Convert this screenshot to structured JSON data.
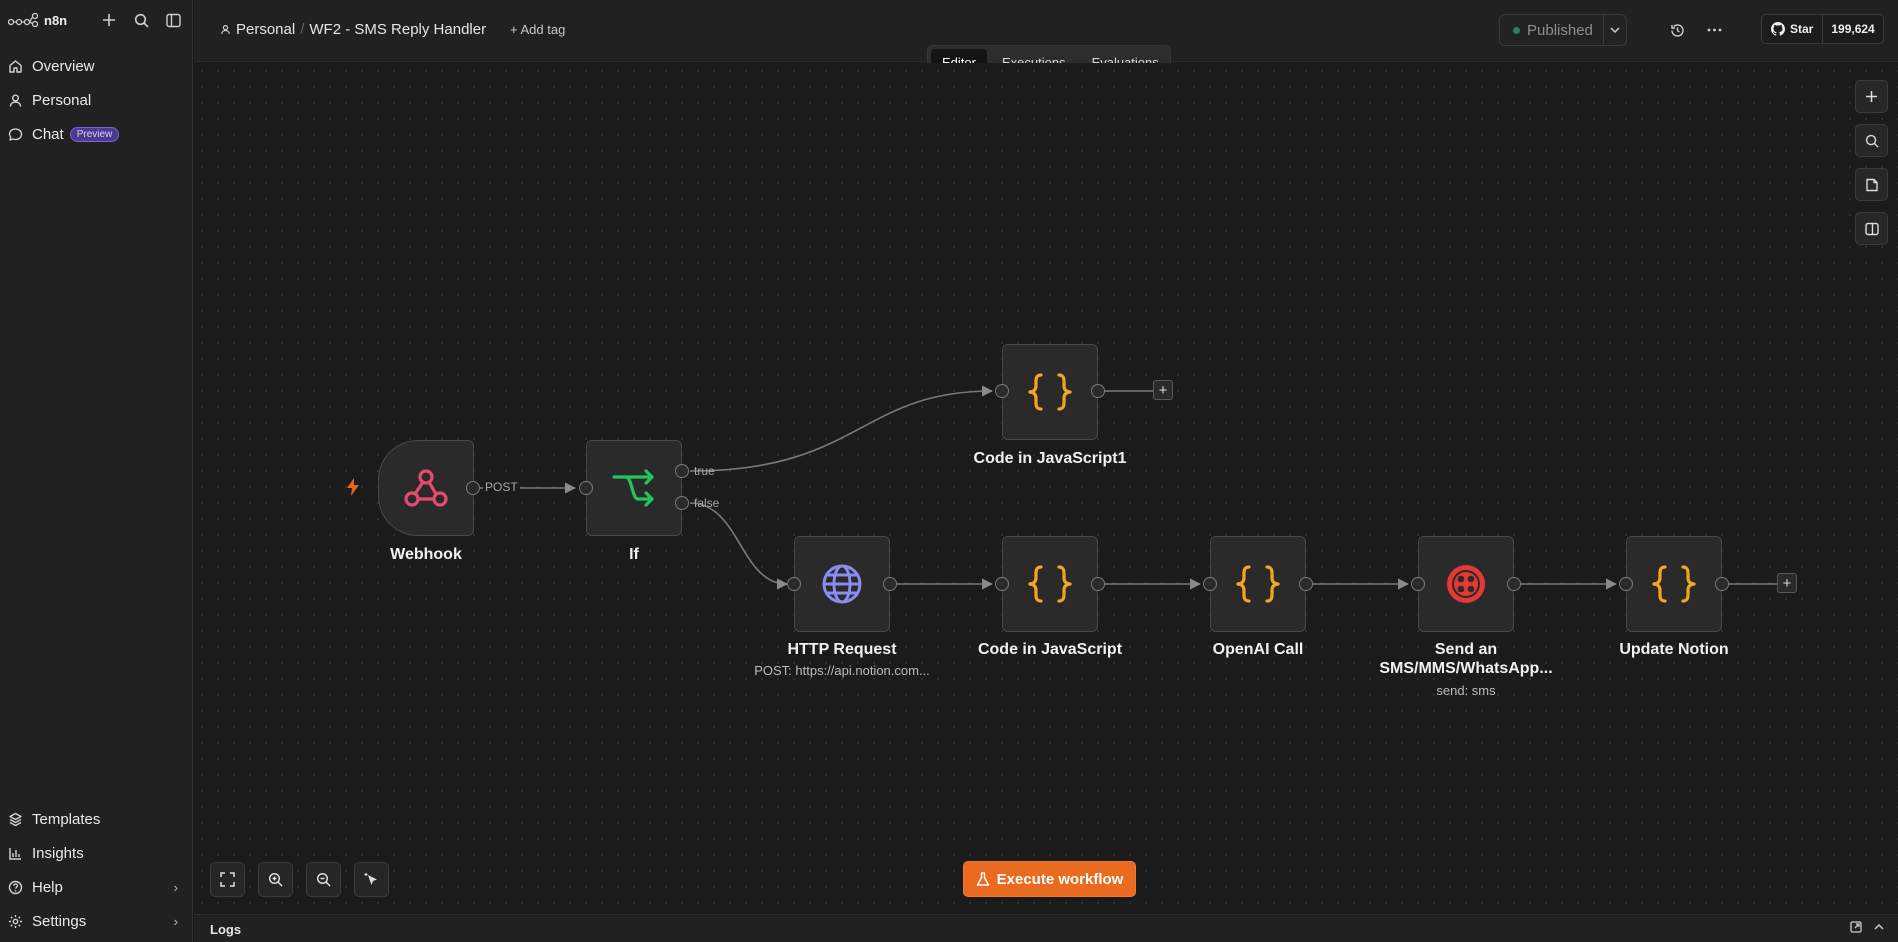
{
  "app": {
    "brand": "n8n"
  },
  "sidebar": {
    "items": [
      {
        "label": "Overview",
        "icon": "home-icon"
      },
      {
        "label": "Personal",
        "icon": "user-icon"
      },
      {
        "label": "Chat",
        "icon": "chat-icon",
        "badge": "Preview"
      }
    ],
    "bottom_items": [
      {
        "label": "Templates",
        "icon": "templates-icon"
      },
      {
        "label": "Insights",
        "icon": "insights-icon"
      },
      {
        "label": "Help",
        "icon": "help-icon"
      },
      {
        "label": "Settings",
        "icon": "settings-icon"
      }
    ]
  },
  "header": {
    "project": "Personal",
    "workflow_name": "WF2 - SMS Reply Handler",
    "add_tag": "+ Add tag",
    "status": "Published",
    "github_star": "Star",
    "github_count": "199,624"
  },
  "tabs": [
    {
      "label": "Editor",
      "active": true
    },
    {
      "label": "Executions",
      "active": false
    },
    {
      "label": "Evaluations",
      "active": false
    }
  ],
  "nodes": {
    "webhook": {
      "label": "Webhook"
    },
    "if": {
      "label": "If"
    },
    "code1": {
      "label": "Code in JavaScript1"
    },
    "http": {
      "label": "HTTP Request",
      "sub": "POST: https://api.notion.com..."
    },
    "code": {
      "label": "Code in JavaScript"
    },
    "openai": {
      "label": "OpenAI Call"
    },
    "sms": {
      "label_line1": "Send an",
      "label_line2": "SMS/MMS/WhatsApp...",
      "sub": "send: sms"
    },
    "notion": {
      "label": "Update Notion"
    }
  },
  "edges": {
    "post": "POST",
    "true": "true",
    "false": "false"
  },
  "actions": {
    "execute": "Execute workflow"
  },
  "logs": {
    "label": "Logs"
  },
  "colors": {
    "accent": "#ea6a1f",
    "webhook": "#e84a6f",
    "if": "#22c55e",
    "code": "#f5a524",
    "http": "#8b8cf0",
    "twilio": "#e53935"
  }
}
